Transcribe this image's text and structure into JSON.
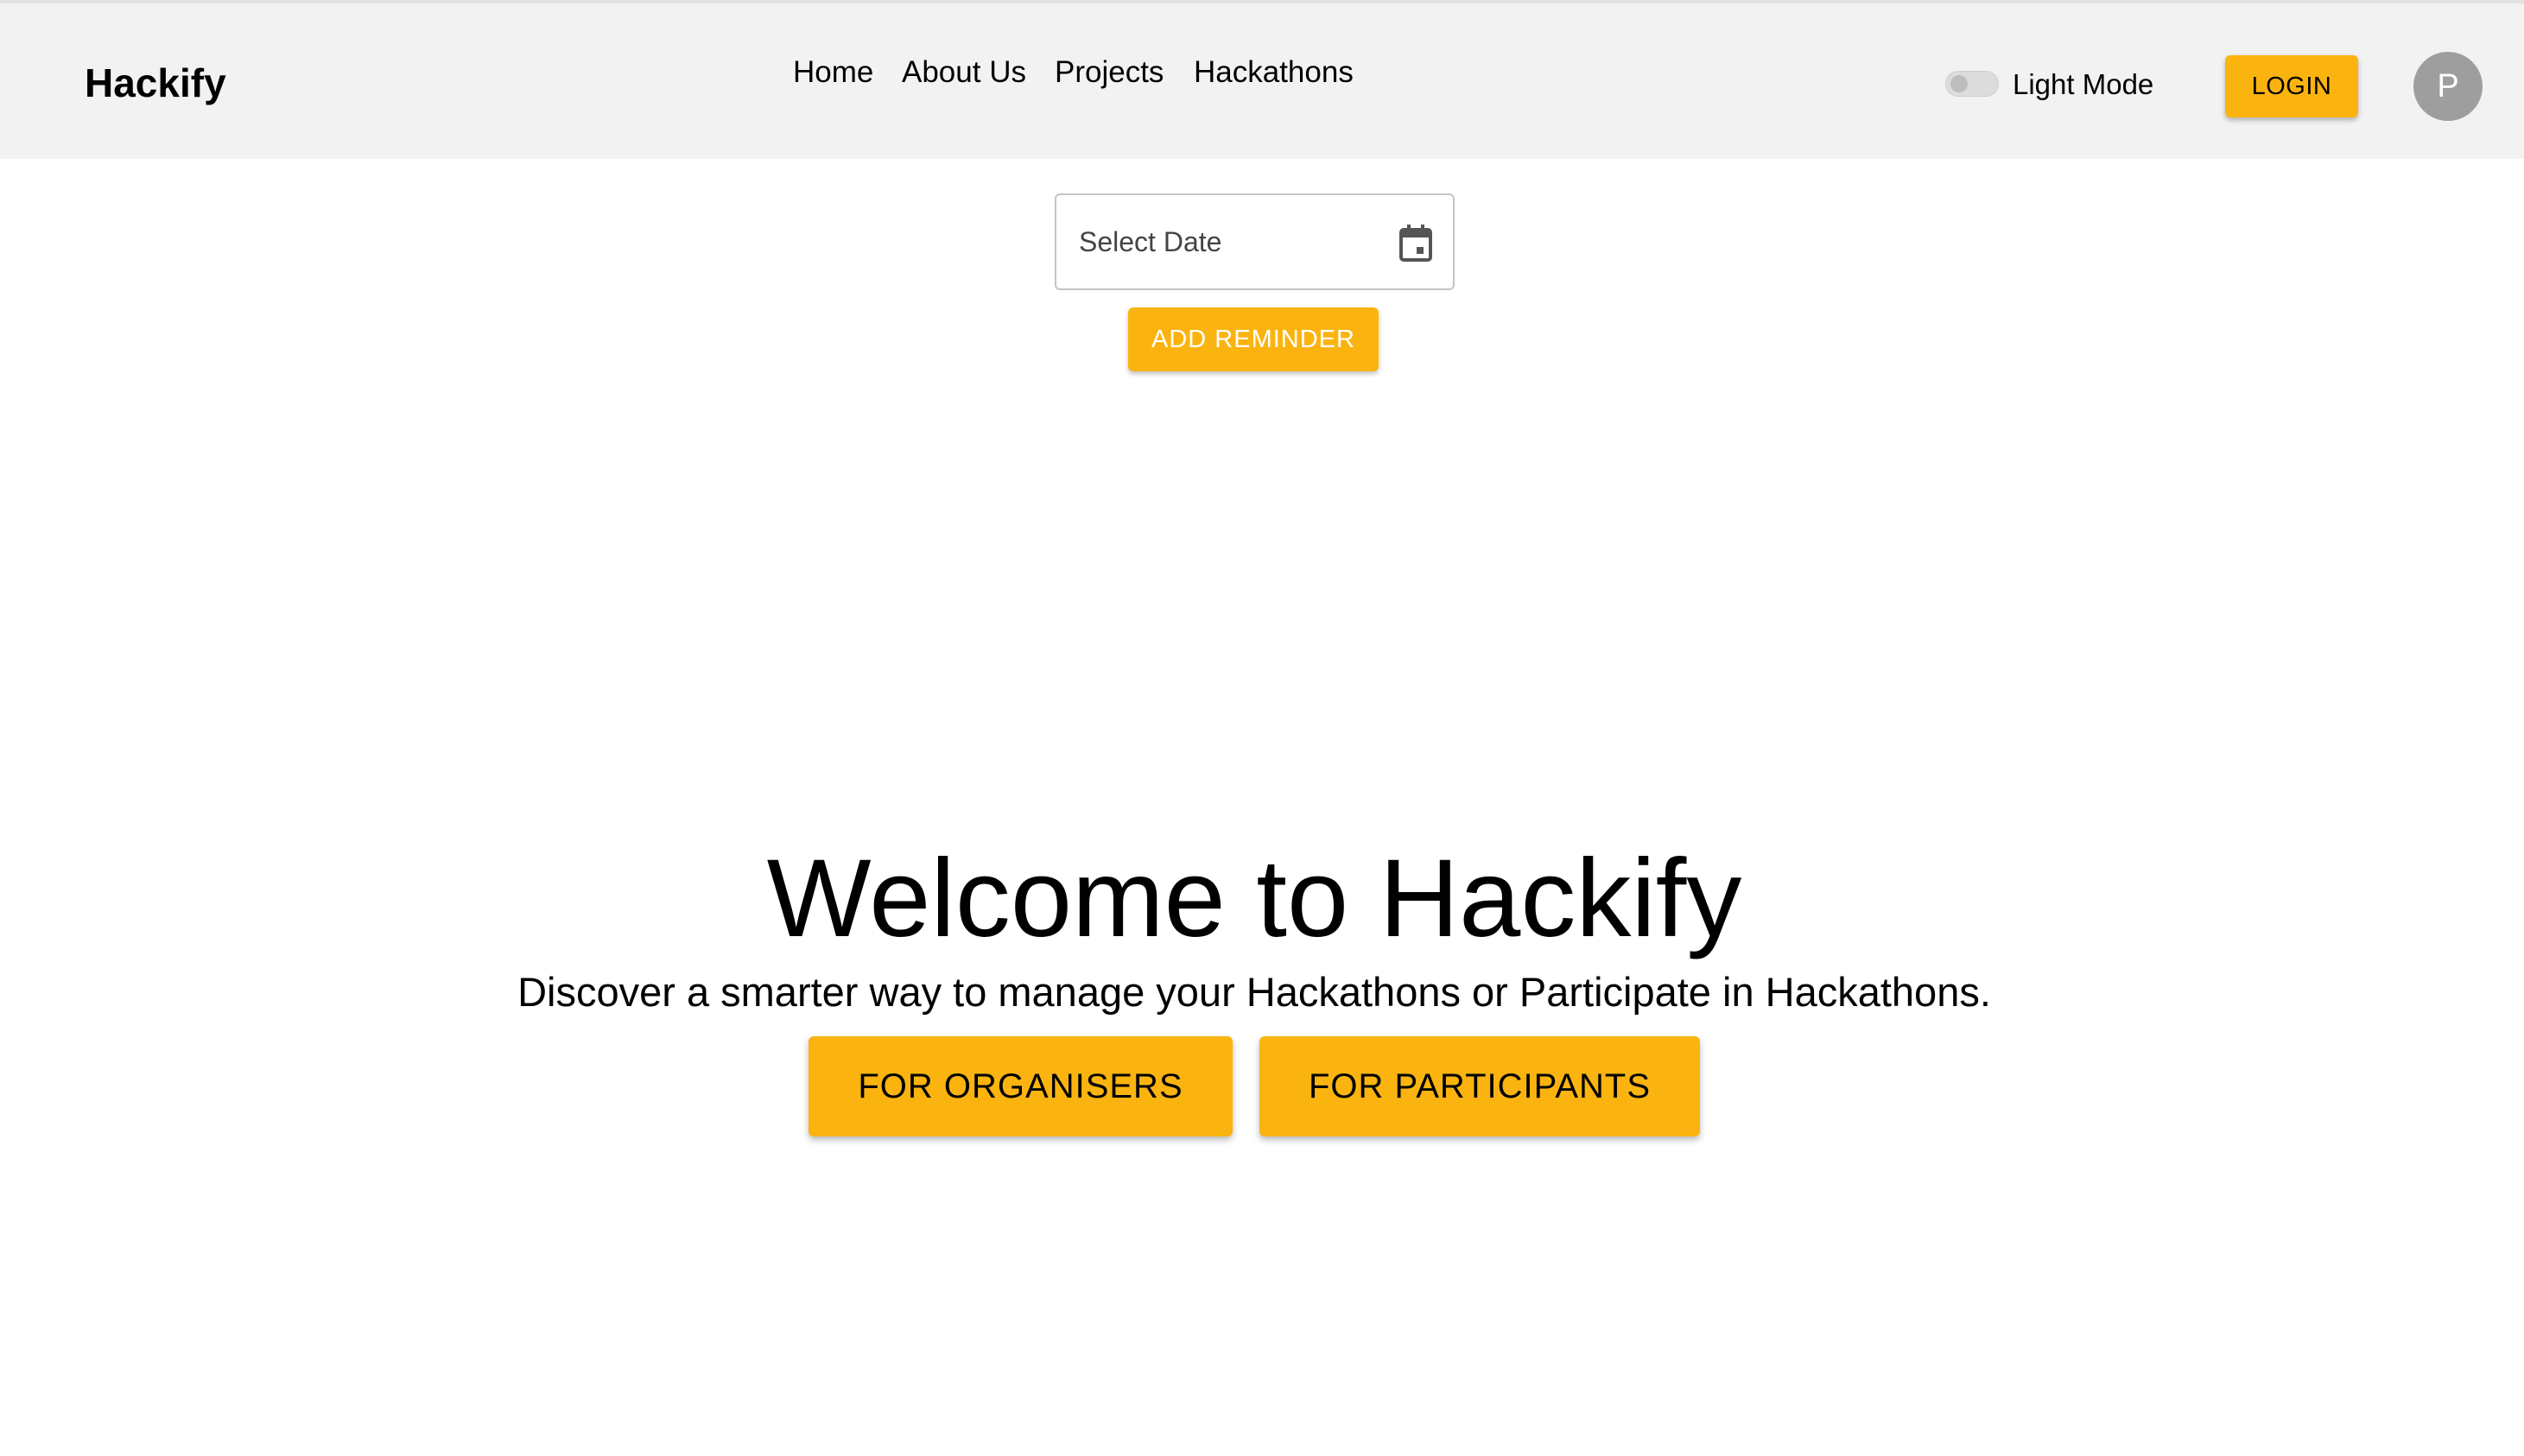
{
  "header": {
    "brand": "Hackify",
    "nav": [
      "Home",
      "About Us",
      "Projects",
      "Hackathons"
    ],
    "theme_toggle": {
      "label": "Light Mode",
      "checked": false
    },
    "login_label": "LOGIN",
    "avatar_initial": "P"
  },
  "reminder": {
    "date_placeholder": "Select Date",
    "calendar_icon": "calendar-icon",
    "add_label": "ADD REMINDER"
  },
  "hero": {
    "title": "Welcome to Hackify",
    "subtitle": "Discover a smarter way to manage your Hackathons or Participate in Hackathons.",
    "organisers_label": "FOR ORGANISERS",
    "participants_label": "FOR PARTICIPANTS"
  },
  "colors": {
    "accent": "#fbb40f",
    "header_bg": "#f2f2f2",
    "avatar_bg": "#9e9e9e"
  }
}
